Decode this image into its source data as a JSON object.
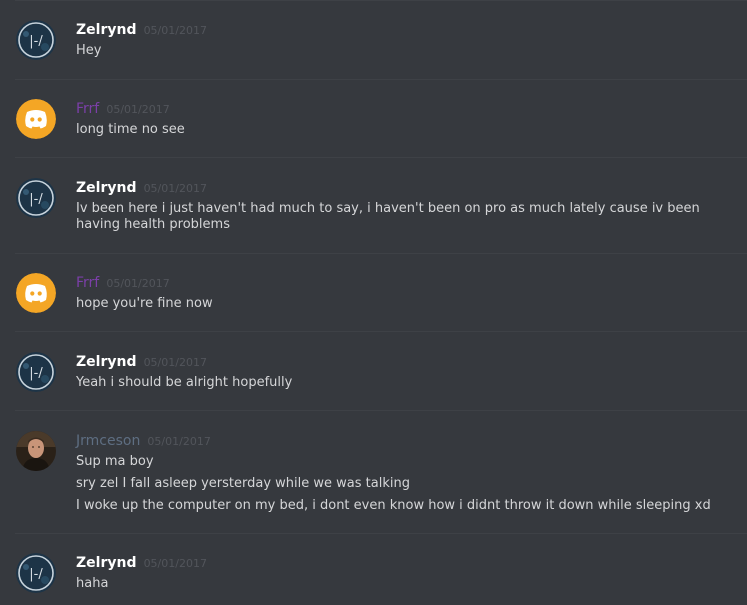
{
  "colors": {
    "background": "#36393e",
    "zelrynd": "#ffffff",
    "frrf": "#7b3fa8",
    "jrmceson": "#5e6e82",
    "timestamp": "#52555b",
    "message_text": "#d5d6d8",
    "divider": "#3e4146",
    "discord_avatar_bg": "#f4a625"
  },
  "messages": [
    {
      "author": "Zelrynd",
      "timestamp": "05/01/2017",
      "avatar": "zelrynd-avatar-icon",
      "lines": [
        "Hey"
      ]
    },
    {
      "author": "Frrf",
      "timestamp": "05/01/2017",
      "avatar": "discord-default-avatar-icon",
      "lines": [
        "long time no see"
      ]
    },
    {
      "author": "Zelrynd",
      "timestamp": "05/01/2017",
      "avatar": "zelrynd-avatar-icon",
      "lines": [
        "Iv been here i just haven't had much to say, i haven't been on pro as much lately cause iv been having health problems"
      ]
    },
    {
      "author": "Frrf",
      "timestamp": "05/01/2017",
      "avatar": "discord-default-avatar-icon",
      "lines": [
        "hope you're fine now"
      ]
    },
    {
      "author": "Zelrynd",
      "timestamp": "05/01/2017",
      "avatar": "zelrynd-avatar-icon",
      "lines": [
        "Yeah i should be alright hopefully"
      ]
    },
    {
      "author": "Jrmceson",
      "timestamp": "05/01/2017",
      "avatar": "user-photo-avatar",
      "lines": [
        "Sup ma boy",
        "sry zel I fall asleep yersterday while we was talking",
        "I woke up the computer on my bed, i dont even know how i didnt throw it down while sleeping xd"
      ]
    },
    {
      "author": "Zelrynd",
      "timestamp": "05/01/2017",
      "avatar": "zelrynd-avatar-icon",
      "lines": [
        "haha"
      ]
    }
  ]
}
